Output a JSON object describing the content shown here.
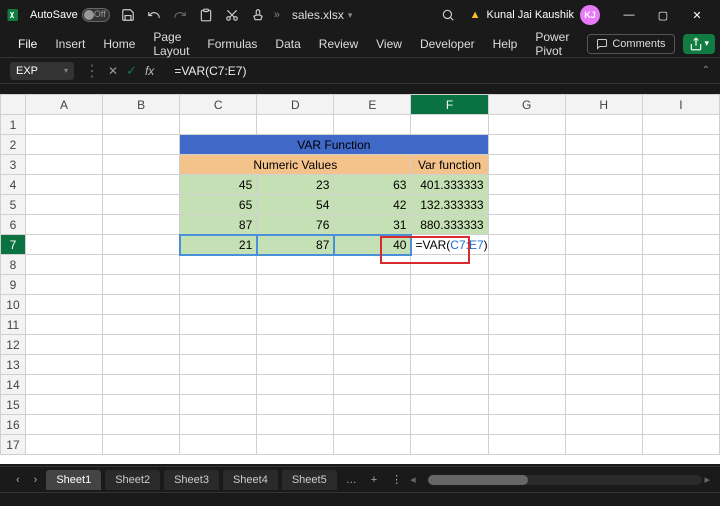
{
  "titlebar": {
    "autosave_label": "AutoSave",
    "autosave_state": "Off",
    "filename": "sales.xlsx",
    "user_name": "Kunal Jai Kaushik",
    "user_initials": "KJ"
  },
  "ribbon": {
    "tabs": [
      "File",
      "Insert",
      "Home",
      "Page Layout",
      "Formulas",
      "Data",
      "Review",
      "View",
      "Developer",
      "Help",
      "Power Pivot"
    ],
    "comments": "Comments"
  },
  "formula_bar": {
    "name_box": "EXP",
    "formula": "=VAR(C7:E7)"
  },
  "columns": [
    "A",
    "B",
    "C",
    "D",
    "E",
    "F",
    "G",
    "H",
    "I"
  ],
  "rows": [
    "1",
    "2",
    "3",
    "4",
    "5",
    "6",
    "7",
    "8",
    "9",
    "10",
    "11",
    "12",
    "13",
    "14",
    "15",
    "16",
    "17"
  ],
  "cells": {
    "title": "VAR Function",
    "header_numeric": "Numeric Values",
    "header_var": "Var function",
    "r4": {
      "c": "45",
      "d": "23",
      "e": "63",
      "f": "401.333333"
    },
    "r5": {
      "c": "65",
      "d": "54",
      "e": "42",
      "f": "132.333333"
    },
    "r6": {
      "c": "87",
      "d": "76",
      "e": "31",
      "f": "880.333333"
    },
    "r7": {
      "c": "21",
      "d": "87",
      "e": "40",
      "f_prefix": "=VAR(",
      "f_ref": "C7:E7",
      "f_suffix": ")"
    }
  },
  "sheet_tabs": [
    "Sheet1",
    "Sheet2",
    "Sheet3",
    "Sheet4",
    "Sheet5"
  ],
  "active_cell": "F7"
}
